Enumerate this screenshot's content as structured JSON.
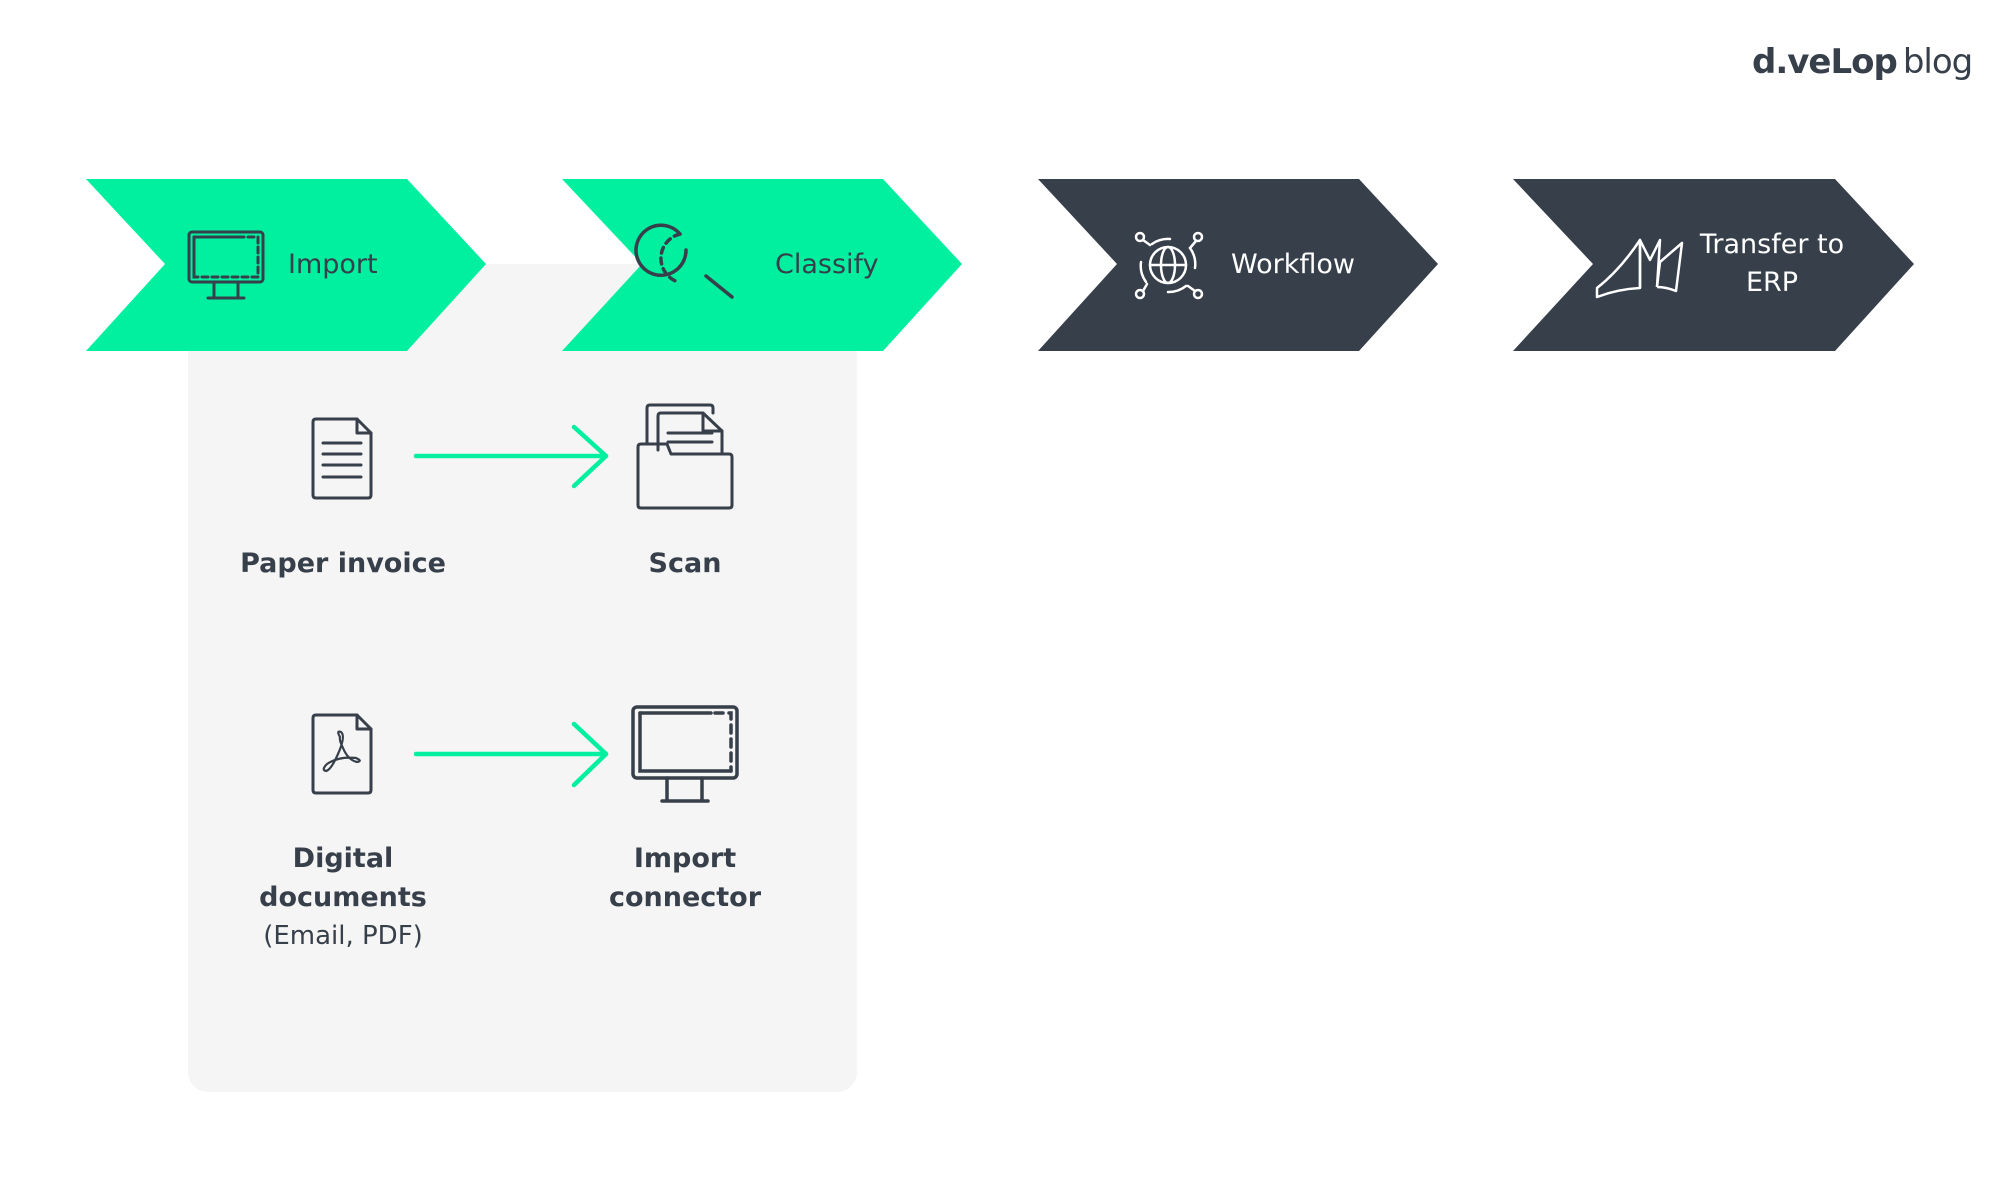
{
  "logo": {
    "brand": "d.veLop",
    "suffix": "blog"
  },
  "colors": {
    "accent": "#00f0a0",
    "dark": "#363f4a",
    "panel": "#f5f5f5",
    "text": "#363f4a"
  },
  "steps": [
    {
      "label": "Import",
      "icon": "monitor-icon",
      "state": "active"
    },
    {
      "label": "Classify",
      "icon": "search-icon",
      "state": "active"
    },
    {
      "label": "Workflow",
      "icon": "globe-network-icon",
      "state": "inactive"
    },
    {
      "label": "Transfer to ERP",
      "line1": "Transfer to",
      "line2": "ERP",
      "icon": "erp-sails-icon",
      "state": "inactive"
    }
  ],
  "import_detail": {
    "rows": [
      {
        "source": {
          "label": "Paper invoice",
          "icon": "paper-document-icon"
        },
        "target": {
          "label": "Scan",
          "icon": "folder-documents-icon"
        }
      },
      {
        "source": {
          "label_line1": "Digital",
          "label_line2": "documents",
          "sub": "(Email, PDF)",
          "icon": "pdf-document-icon"
        },
        "target": {
          "label_line1": "Import",
          "label_line2": "connector",
          "icon": "monitor-icon"
        }
      }
    ]
  }
}
